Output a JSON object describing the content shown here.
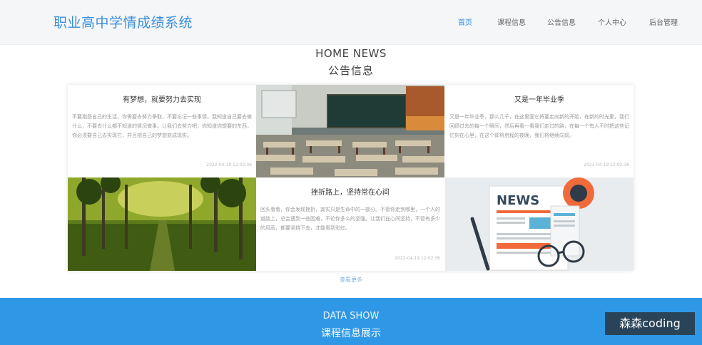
{
  "header": {
    "logo": "职业高中学情成绩系统",
    "nav": [
      {
        "label": "首页",
        "active": true
      },
      {
        "label": "课程信息",
        "active": false
      },
      {
        "label": "公告信息",
        "active": false
      },
      {
        "label": "个人中心",
        "active": false
      },
      {
        "label": "后台管理",
        "active": false
      }
    ]
  },
  "news_section": {
    "title_en": "HOME NEWS",
    "title_cn": "公告信息",
    "cards": [
      {
        "title": "有梦想，就要努力去实现",
        "body": "不要抱怨自己的生活，你需要去努力争取，不要忘记一些事情。我知道自己要去做什么，不要去什么都不知道的情况做事。让我们去努力吧，你知道你想要的东西，你必须要自己去实现它，并且把自己的梦想变成现实。",
        "date": "2022-04-19 12:02:36"
      },
      {
        "title": "又是一年毕业季",
        "body": "又是一年毕业季，那么几千，在这里面它将要走向新的开始，在新的时光里，我们回顾过去的每一个瞬间，然后再看一看我们走过的路，在每一个有人不时把这些记忆刻在心里，在这个即将启程的夜晚，我们将继续向前。",
        "date": "2022-04-19 12:02:36"
      },
      {
        "title": "挫折路上，坚持常在心间",
        "body": "回头看看，你会发现挫折，其实只是生命中的一部分。不管你走到哪里，一个人的道路上，总会遇到一些困难，不论你多么的坚强。让我们在心间坚持，不管有多少的风雨，都要坚持下去，才能看到彩虹。",
        "date": "2022-04-19 12:02:36"
      }
    ],
    "more_link": "查看更多"
  },
  "data_section": {
    "title_en": "DATA SHOW",
    "title_cn": "课程信息展示"
  },
  "watermark": "森森coding",
  "colors": {
    "primary": "#2f98e6",
    "logo": "#3a8fd8",
    "nav_active": "#2f8ee0"
  }
}
